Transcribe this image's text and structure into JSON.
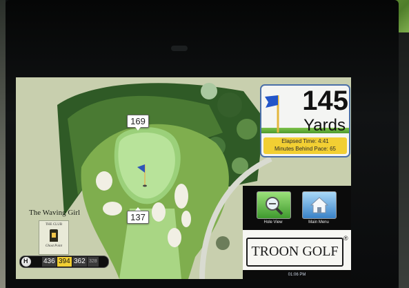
{
  "course": {
    "name": "The Waving Girl",
    "club_logo_title": "THE CLUB",
    "club_logo_sub": "Ghost Point"
  },
  "map": {
    "back_distance": "169",
    "front_distance": "137"
  },
  "yardage": {
    "value": "145",
    "unit": "Yards",
    "elapsed_time": "Elapsed Time: 4:41",
    "behind_pace": "Minutes Behind Pace: 65"
  },
  "controls": {
    "hole_view_label": "Hole View",
    "main_menu_label": "Main Menu"
  },
  "brand": {
    "logo_text": "TROON GOLF",
    "registered_mark": "®"
  },
  "clock": "01:06 PM",
  "hole_info": {
    "hole_label": "H",
    "yardages": [
      "436",
      "394",
      "362",
      "328"
    ]
  },
  "colors": {
    "accent_yellow": "#f2cf33",
    "yard_box_border": "#4a6fa8",
    "fairway_green": "#7fae4e"
  }
}
